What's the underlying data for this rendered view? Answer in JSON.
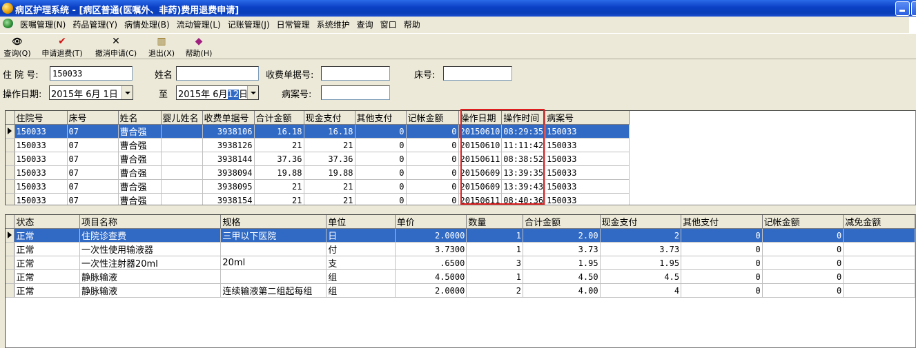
{
  "window": {
    "title": "病区护理系统 - [病区普通(医嘱外、非药)费用退费申请]"
  },
  "menu": [
    "医嘱管理(N)",
    "药品管理(Y)",
    "病情处理(B)",
    "流动管理(L)",
    "记账管理(J)",
    "日常管理",
    "系统维护",
    "查询",
    "窗口",
    "帮助"
  ],
  "toolbar": [
    {
      "label": "查询(Q)",
      "icon": "binoculars-icon"
    },
    {
      "label": "申请退费(T)",
      "icon": "checkmark-icon"
    },
    {
      "label": "撤消申请(C)",
      "icon": "x-icon"
    },
    {
      "label": "退出(X)",
      "icon": "exit-door-icon"
    },
    {
      "label": "帮助(H)",
      "icon": "book-icon"
    }
  ],
  "filters": {
    "inpatient_no_label": "住 院 号:",
    "inpatient_no_value": "150033",
    "name_label": "姓名",
    "name_value": "",
    "receipt_no_label": "收费单据号:",
    "receipt_no_value": "",
    "bed_no_label": "床号:",
    "bed_no_value": "",
    "op_date_label": "操作日期:",
    "op_date_from_prefix": "2015年 6月 1日",
    "to_label": "至",
    "op_date_to_prefix": "2015年 6月",
    "op_date_to_day": "12",
    "op_date_to_suffix": "日",
    "case_no_label": "病案号:",
    "case_no_value": ""
  },
  "top_grid": {
    "columns": [
      "住院号",
      "床号",
      "姓名",
      "婴儿姓名",
      "收费单据号",
      "合计金额",
      "现金支付",
      "其他支付",
      "记帐金额",
      "操作日期",
      "操作时间",
      "病案号"
    ],
    "rows": [
      [
        "150033",
        "07",
        "曹合强",
        "",
        "3938106",
        "16.18",
        "16.18",
        "0",
        "0",
        "20150610",
        "08:29:35",
        "150033"
      ],
      [
        "150033",
        "07",
        "曹合强",
        "",
        "3938126",
        "21",
        "21",
        "0",
        "0",
        "20150610",
        "11:11:42",
        "150033"
      ],
      [
        "150033",
        "07",
        "曹合强",
        "",
        "3938144",
        "37.36",
        "37.36",
        "0",
        "0",
        "20150611",
        "08:38:52",
        "150033"
      ],
      [
        "150033",
        "07",
        "曹合强",
        "",
        "3938094",
        "19.88",
        "19.88",
        "0",
        "0",
        "20150609",
        "13:39:35",
        "150033"
      ],
      [
        "150033",
        "07",
        "曹合强",
        "",
        "3938095",
        "21",
        "21",
        "0",
        "0",
        "20150609",
        "13:39:43",
        "150033"
      ],
      [
        "150033",
        "07",
        "曹合强",
        "",
        "3938154",
        "21",
        "21",
        "0",
        "0",
        "20150611",
        "08:40:36",
        "150033"
      ]
    ]
  },
  "bottom_grid": {
    "columns": [
      "状态",
      "项目名称",
      "规格",
      "单位",
      "单价",
      "数量",
      "合计金额",
      "现金支付",
      "其他支付",
      "记帐金额",
      "减免金额"
    ],
    "rows": [
      [
        "正常",
        "住院诊查费",
        "三甲以下医院",
        "日",
        "2.0000",
        "1",
        "2.00",
        "2",
        "0",
        "0",
        ""
      ],
      [
        "正常",
        "一次性使用输液器",
        "",
        "付",
        "3.7300",
        "1",
        "3.73",
        "3.73",
        "0",
        "0",
        ""
      ],
      [
        "正常",
        "一次性注射器20ml",
        "20ml",
        "支",
        ".6500",
        "3",
        "1.95",
        "1.95",
        "0",
        "0",
        ""
      ],
      [
        "正常",
        "静脉输液",
        "",
        "组",
        "4.5000",
        "1",
        "4.50",
        "4.5",
        "0",
        "0",
        ""
      ],
      [
        "正常",
        "静脉输液",
        "连续输液第二组起每组",
        "组",
        "2.0000",
        "2",
        "4.00",
        "4",
        "0",
        "0",
        ""
      ]
    ]
  },
  "colors": {
    "selection": "#316ac5",
    "highlight_box": "#e02020",
    "titlebar": "#0a3fc4"
  }
}
